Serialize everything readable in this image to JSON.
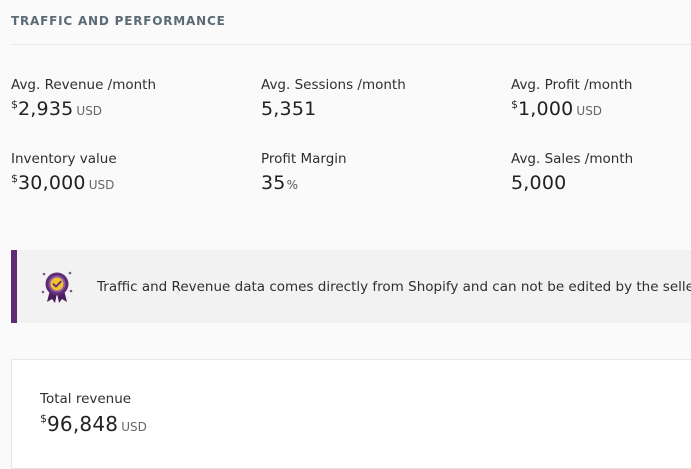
{
  "section": {
    "title": "TRAFFIC AND PERFORMANCE"
  },
  "metrics": [
    {
      "label": "Avg. Revenue /month",
      "currency": "$",
      "value": "2,935",
      "unit": "USD"
    },
    {
      "label": "Avg. Sessions /month",
      "value": "5,351"
    },
    {
      "label": "Avg. Profit /month",
      "currency": "$",
      "value": "1,000",
      "unit": "USD"
    },
    {
      "label": "Inventory value",
      "currency": "$",
      "value": "30,000",
      "unit": "USD"
    },
    {
      "label": "Profit Margin",
      "value": "35",
      "percent": "%"
    },
    {
      "label": "Avg. Sales /month",
      "value": "5,000"
    }
  ],
  "notice": {
    "text": "Traffic and Revenue data comes directly from Shopify and can not be edited by the seller.",
    "icon": "verified-badge-icon",
    "accent_color": "#5e2b74"
  },
  "total_card": {
    "label": "Total revenue",
    "currency": "$",
    "value": "96,848",
    "unit": "USD"
  }
}
